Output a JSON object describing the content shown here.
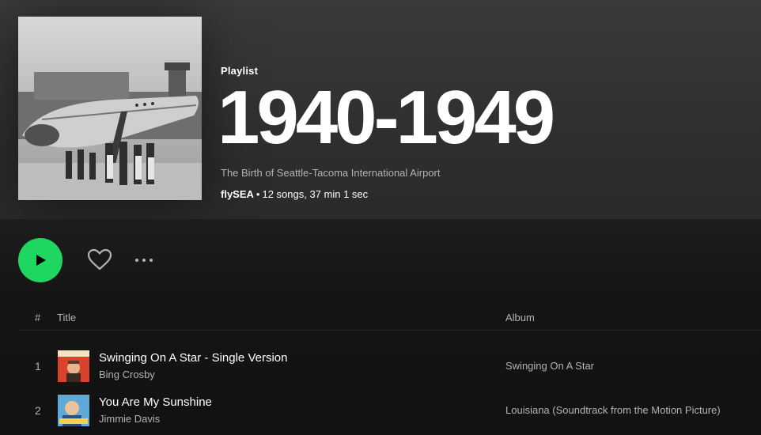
{
  "playlist": {
    "type_label": "Playlist",
    "title": "1940-1949",
    "description": "The Birth of Seattle-Tacoma International Airport",
    "owner": "flySEA",
    "separator": "•",
    "stats": "12 songs, 37 min 1 sec"
  },
  "actions": {
    "play_icon": "play-icon",
    "like_icon": "heart-icon",
    "more_icon": "more-horizontal-icon",
    "accent_color": "#1ed760"
  },
  "tracklist": {
    "columns": {
      "number": "#",
      "title": "Title",
      "album": "Album"
    },
    "rows": [
      {
        "number": "1",
        "title": "Swinging On A Star - Single Version",
        "artist": "Bing Crosby",
        "album": "Swinging On A Star"
      },
      {
        "number": "2",
        "title": "You Are My Sunshine",
        "artist": "Jimmie Davis",
        "album": "Louisiana (Soundtrack from the Motion Picture)"
      }
    ]
  }
}
